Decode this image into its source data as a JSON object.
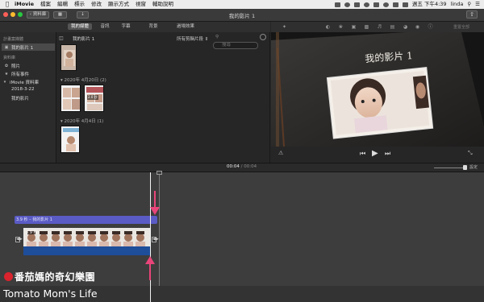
{
  "menubar": {
    "app_name": "iMovie",
    "items": [
      "檔案",
      "編輯",
      "標示",
      "修改",
      "顯示方式",
      "視窗",
      "輔助說明"
    ],
    "clock": "週五 下午4:39",
    "user": "linda"
  },
  "toolbar": {
    "back_label": "資料庫",
    "window_title": "我的影片 1",
    "share_icon": "share-icon"
  },
  "media_tabs": {
    "items": [
      "我的媒體",
      "音訊",
      "字幕",
      "背景",
      "過場效果"
    ],
    "active": "我的媒體"
  },
  "sidebar": {
    "projects_header": "計畫案媒體",
    "project_item": "我的影片 1",
    "libraries_header": "資料庫",
    "items": [
      {
        "label": "照片",
        "icon": "photo-icon"
      },
      {
        "label": "所有事件",
        "icon": "star-icon"
      },
      {
        "label": "iMovie 資料庫",
        "icon": "disclosure-triangle-icon"
      },
      {
        "label": "2018-3-22",
        "icon": ""
      },
      {
        "label": "我的影片",
        "icon": ""
      }
    ]
  },
  "browser": {
    "title": "我的影片 1",
    "filter": "所有剪輯片段",
    "search_placeholder": "搜尋",
    "groups": [
      {
        "date": "2020年 4月20日",
        "count": "(2)"
      },
      {
        "date": "2020年 4月4日",
        "count": "(1)"
      }
    ],
    "thumb_caption": "2.0 秒"
  },
  "viewer": {
    "title_text": "我的影片 1",
    "reset_label": "重置全部"
  },
  "timeline": {
    "current_time": "00:04",
    "separator": "/",
    "total_time": "00:04",
    "settings_label": "設定",
    "title_clip_label": "3.9 秒 – 我的影片 1",
    "video_clip_label": "3.9 秒"
  },
  "watermark": {
    "chinese": "番茄媽的奇幻樂園",
    "english": "Tomato Mom's Life"
  },
  "colors": {
    "title_clip": "#5a5bc4",
    "video_clip": "#1e4d9a",
    "arrow": "#e8457a",
    "watermark_dot": "#d9232d"
  }
}
